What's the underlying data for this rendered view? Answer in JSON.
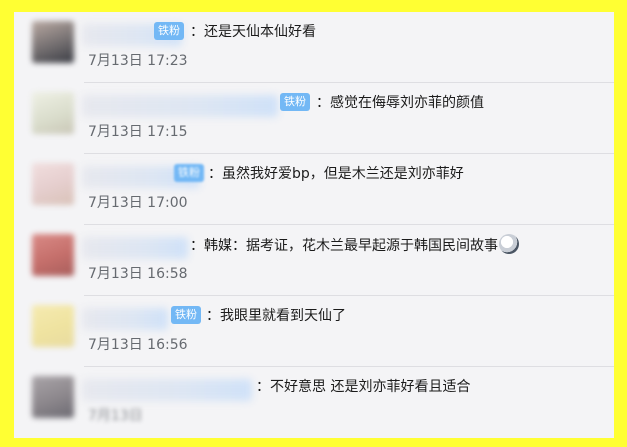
{
  "comments": [
    {
      "badge": "铁粉",
      "text": "：还是天仙本仙好看",
      "time": "7月13日 17:23"
    },
    {
      "badge": "铁粉",
      "text": "：感觉在侮辱刘亦菲的颜值",
      "time": "7月13日 17:15"
    },
    {
      "badge": "铁粉",
      "text": "：虽然我好爱bp，但是木兰还是刘亦菲好",
      "time": "7月13日 17:00"
    },
    {
      "badge": "",
      "text": "：韩媒：据考证，花木兰最早起源于韩国民间故事",
      "emoji": "shocked-face-emoji",
      "time": "7月13日 16:58"
    },
    {
      "badge": "铁粉",
      "text": "：我眼里就看到天仙了",
      "time": "7月13日 16:56"
    },
    {
      "badge": "",
      "text": "：不好意思 还是刘亦菲好看且适合",
      "time": "7月13日"
    }
  ],
  "colors": {
    "frame": "#ffff33",
    "panel": "#f4f4f6",
    "badge": "#73b8f5",
    "time": "#666a70"
  }
}
